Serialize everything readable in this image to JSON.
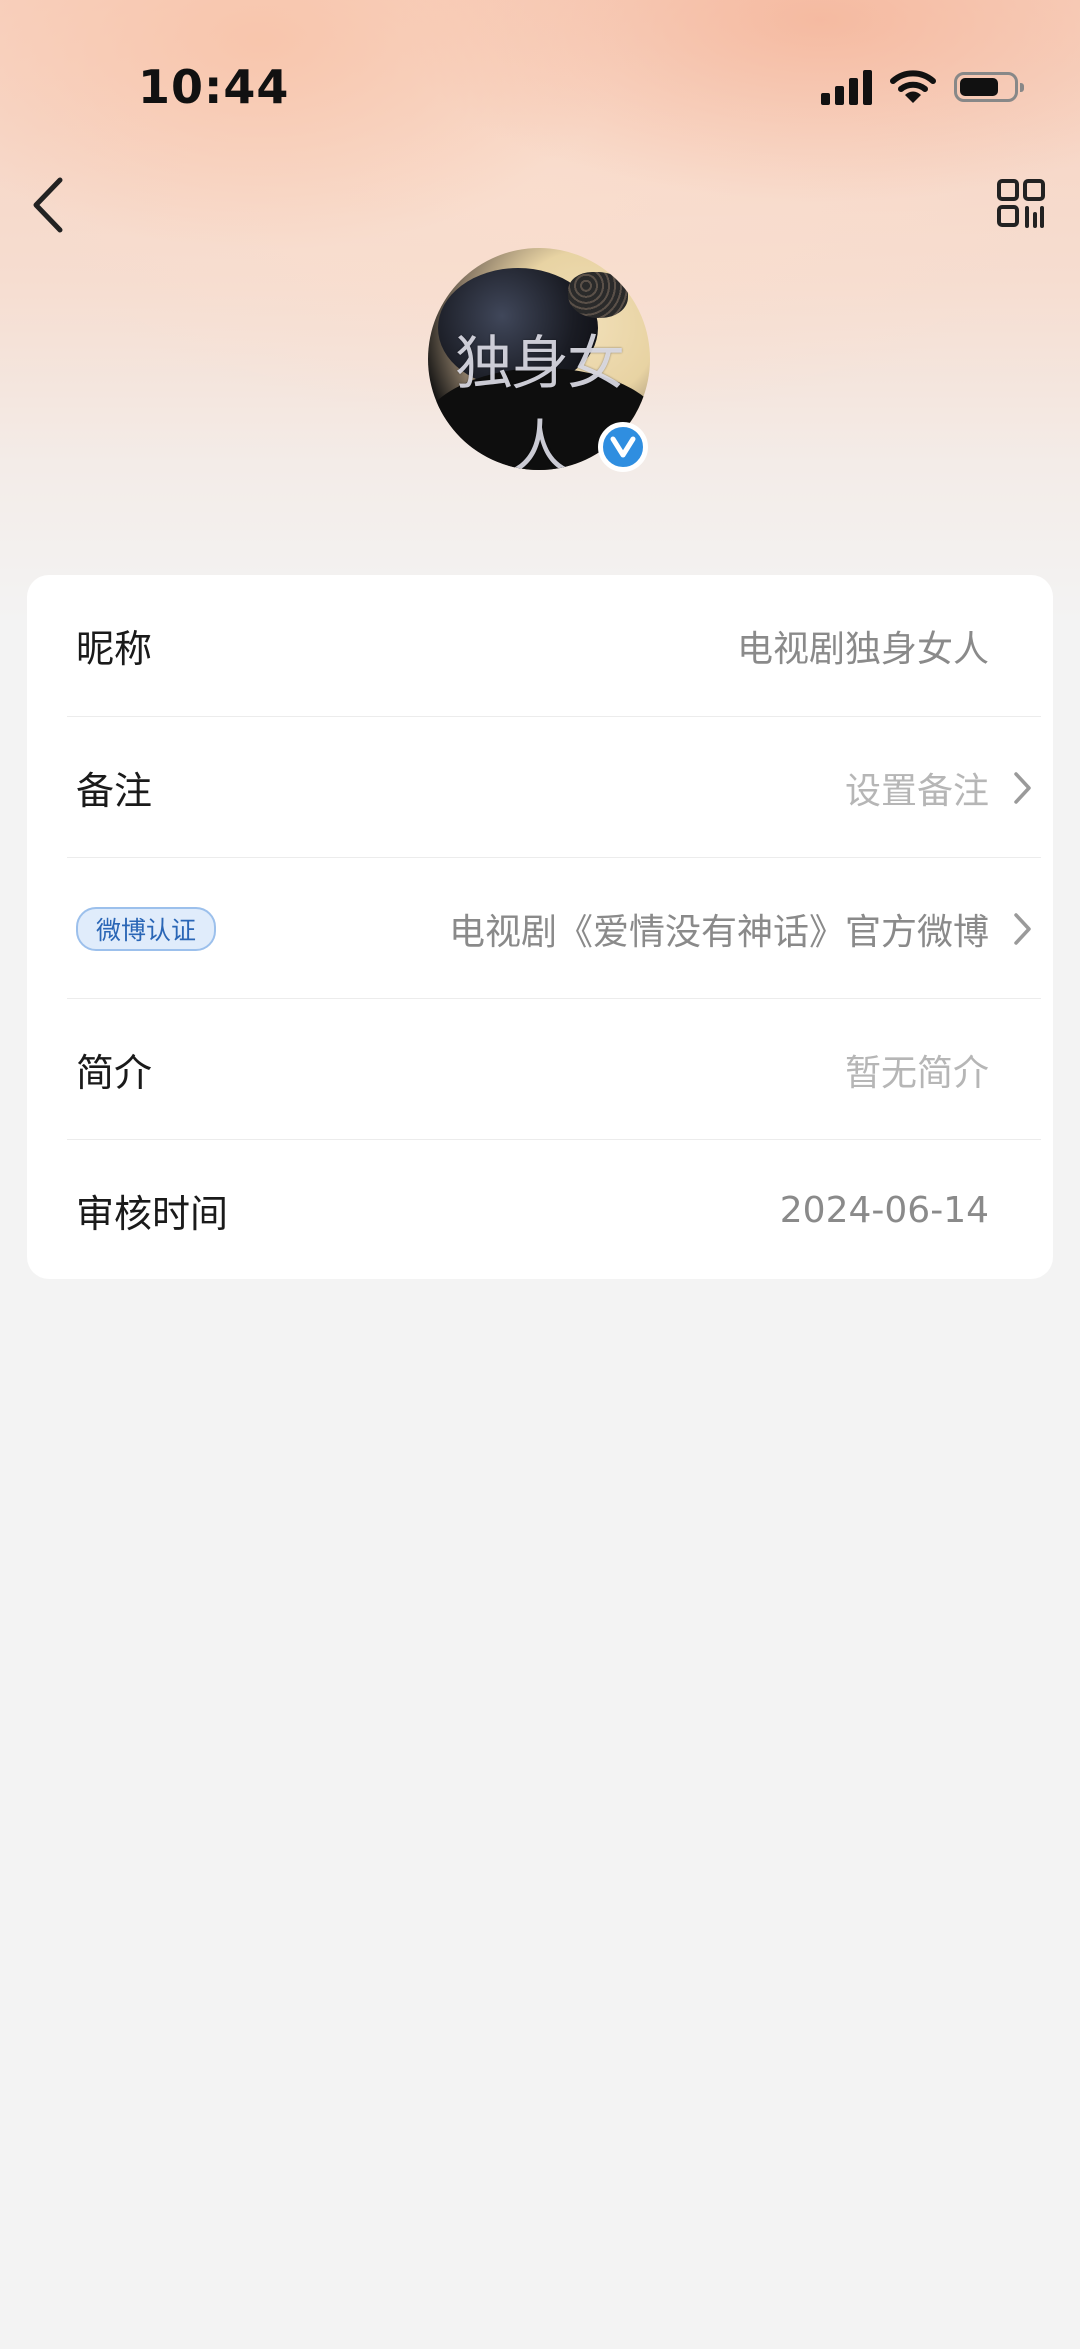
{
  "status_bar": {
    "time": "10:44"
  },
  "profile": {
    "avatar_text": "独身女人"
  },
  "rows": [
    {
      "label": "昵称",
      "value": "电视剧独身女人"
    },
    {
      "label": "备注",
      "value": "设置备注"
    },
    {
      "label": "微博认证",
      "value": "电视剧《爱情没有神话》官方微博"
    },
    {
      "label": "简介",
      "value": "暂无简介"
    },
    {
      "label": "审核时间",
      "value": "2024-06-14"
    }
  ],
  "colors": {
    "verified_blue": "#2f8ee0",
    "badge_text": "#2a66b6"
  },
  "icons": [
    "back-arrow-icon",
    "qr-code-icon",
    "verified-v-icon",
    "chevron-right-icon",
    "wifi-icon",
    "signal-icon",
    "battery-icon"
  ]
}
